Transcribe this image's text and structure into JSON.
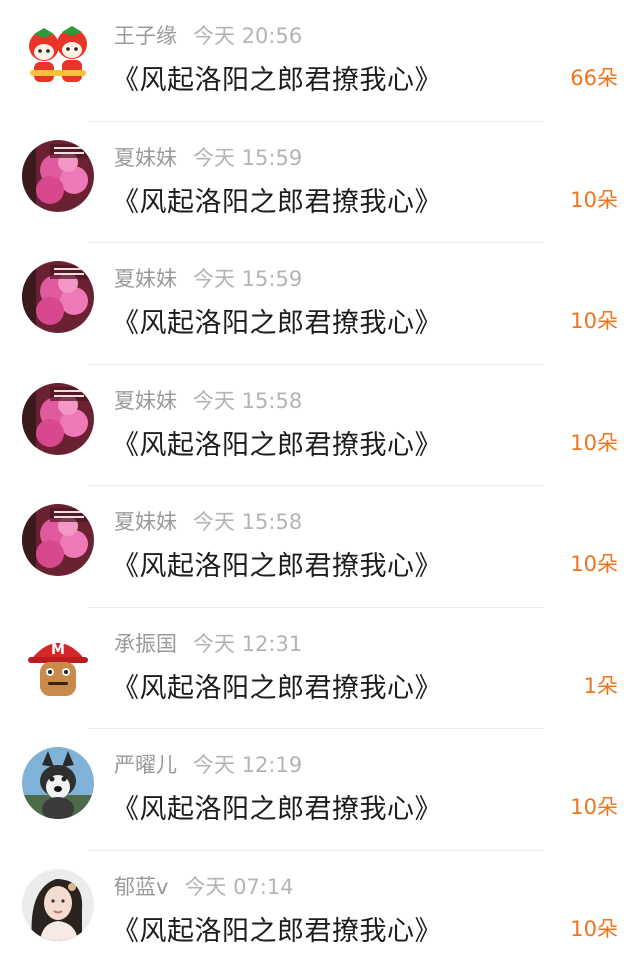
{
  "gifts": [
    {
      "user": "王子缘",
      "time": "今天 20:56",
      "book": "《风起洛阳之郎君撩我心》",
      "count": "66朵",
      "avatar": "strawberry-cartoon-avatar"
    },
    {
      "user": "夏妹妹",
      "time": "今天 15:59",
      "book": "《风起洛阳之郎君撩我心》",
      "count": "10朵",
      "avatar": "pink-blossom-avatar"
    },
    {
      "user": "夏妹妹",
      "time": "今天 15:59",
      "book": "《风起洛阳之郎君撩我心》",
      "count": "10朵",
      "avatar": "pink-blossom-avatar"
    },
    {
      "user": "夏妹妹",
      "time": "今天 15:58",
      "book": "《风起洛阳之郎君撩我心》",
      "count": "10朵",
      "avatar": "pink-blossom-avatar"
    },
    {
      "user": "夏妹妹",
      "time": "今天 15:58",
      "book": "《风起洛阳之郎君撩我心》",
      "count": "10朵",
      "avatar": "pink-blossom-avatar"
    },
    {
      "user": "承振国",
      "time": "今天 12:31",
      "book": "《风起洛阳之郎君撩我心》",
      "count": "1朵",
      "avatar": "red-cap-character-avatar"
    },
    {
      "user": "严曜儿",
      "time": "今天 12:19",
      "book": "《风起洛阳之郎君撩我心》",
      "count": "10朵",
      "avatar": "husky-dog-avatar"
    },
    {
      "user": "郁蓝v",
      "time": "今天 07:14",
      "book": "《风起洛阳之郎君撩我心》",
      "count": "10朵",
      "avatar": "girl-portrait-avatar"
    }
  ],
  "colors": {
    "accent": "#f0731d",
    "name": "#9a9a9a",
    "title": "#1d1d1d"
  }
}
